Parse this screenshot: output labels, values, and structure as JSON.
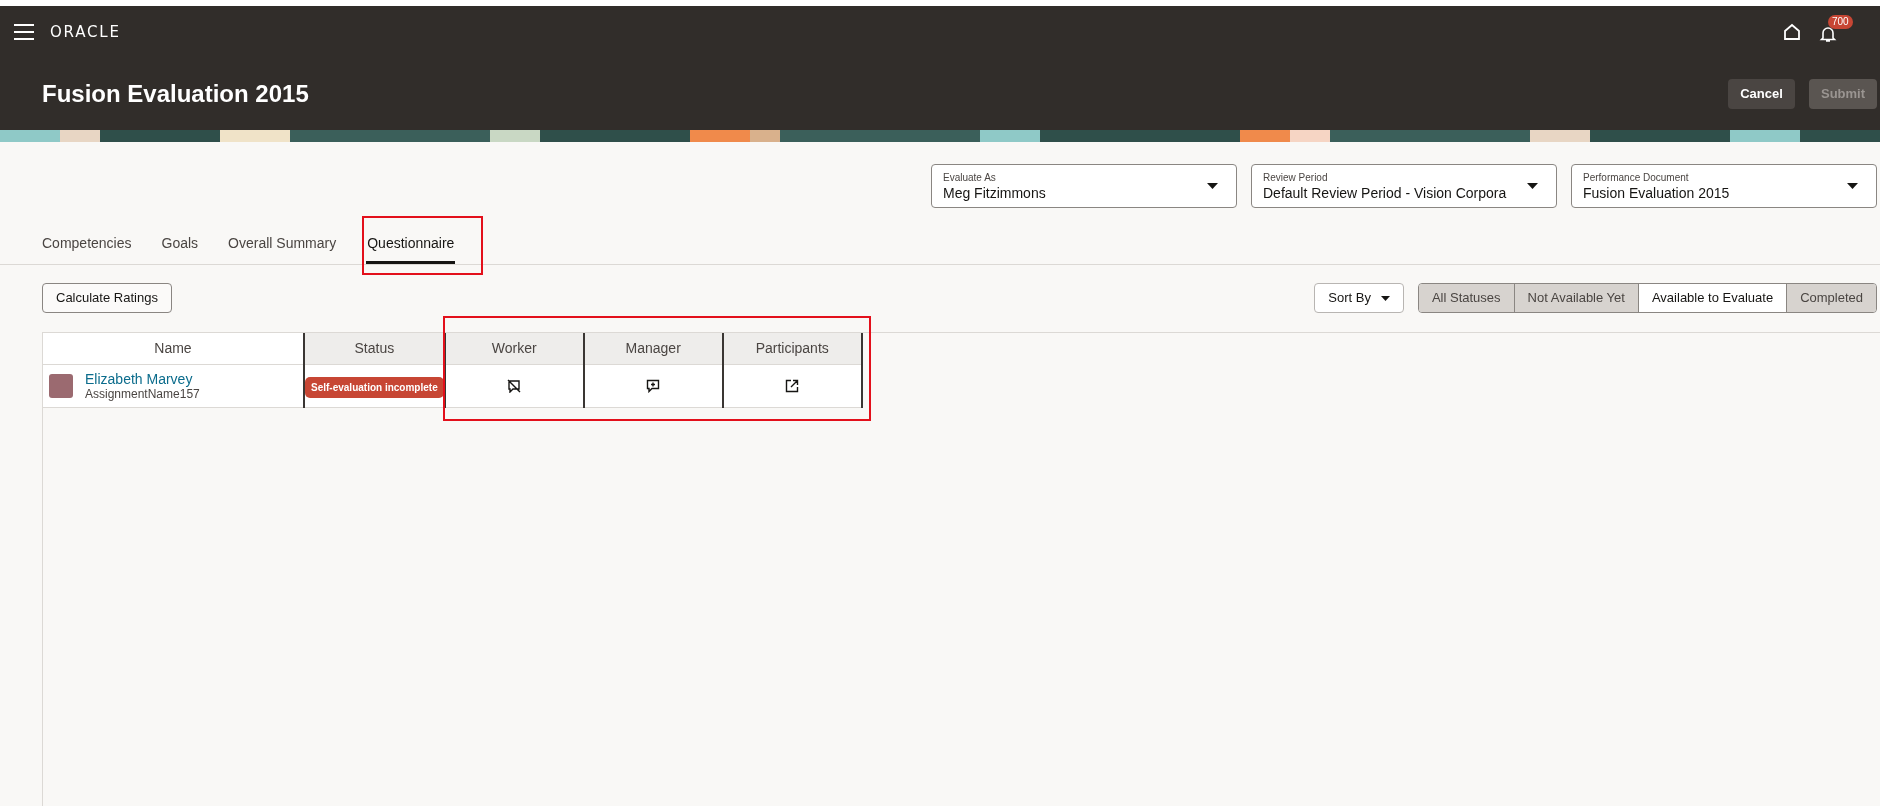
{
  "header": {
    "brand": "ORACLE",
    "notification_count": "700",
    "title": "Fusion Evaluation 2015",
    "buttons": [
      {
        "label": "Cancel",
        "disabled": false
      },
      {
        "label": "Submit",
        "disabled": true
      }
    ]
  },
  "filters": [
    {
      "label": "Evaluate As",
      "value": "Meg Fitzimmons"
    },
    {
      "label": "Review Period",
      "value": "Default Review Period - Vision Corpora"
    },
    {
      "label": "Performance Document",
      "value": "Fusion Evaluation 2015"
    }
  ],
  "tabs": [
    {
      "label": "Competencies",
      "selected": false
    },
    {
      "label": "Goals",
      "selected": false
    },
    {
      "label": "Overall Summary",
      "selected": false
    },
    {
      "label": "Questionnaire",
      "selected": true
    }
  ],
  "toolbar": {
    "calculate_button": "Calculate Ratings",
    "sort_button": "Sort By",
    "status_filters": [
      {
        "label": "All Statuses",
        "selected": true
      },
      {
        "label": "Not Available Yet",
        "selected": true
      },
      {
        "label": "Available to Evaluate",
        "selected": false
      },
      {
        "label": "Completed",
        "selected": true
      }
    ]
  },
  "table": {
    "columns": [
      "Name",
      "Status",
      "Worker",
      "Manager",
      "Participants"
    ],
    "rows": [
      {
        "name": "Elizabeth Marvey",
        "assignment": "AssignmentName157",
        "status": "Self-evaluation incomplete",
        "actions": [
          {
            "kind": "nocomment"
          },
          {
            "kind": "addcomment"
          },
          {
            "kind": "external"
          }
        ]
      }
    ]
  },
  "highlights": {
    "tabs": true,
    "action_columns": true
  }
}
